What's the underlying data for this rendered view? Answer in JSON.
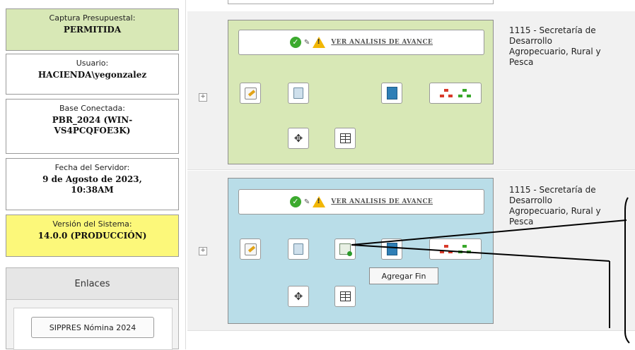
{
  "sidebar": {
    "captura": {
      "label": "Captura Presupuestal:",
      "value": "PERMITIDA"
    },
    "usuario": {
      "label": "Usuario:",
      "value": "HACIENDA\\yegonzalez"
    },
    "base": {
      "label": "Base Conectada:",
      "value_line1": "PBR_2024 (WIN-",
      "value_line2": "VS4PCQFOE3K)"
    },
    "fecha": {
      "label": "Fecha del Servidor:",
      "value_line1": "9 de Agosto de 2023,",
      "value_line2": "10:38AM"
    },
    "version": {
      "label": "Versión del Sistema:",
      "value": "14.0.0 (PRODUCCIÓN)"
    },
    "enlaces": {
      "title": "Enlaces",
      "link_label": "SIPPRES Nómina 2024"
    }
  },
  "rows": [
    {
      "expander": "+",
      "status_bar_label": "VER ANALISIS DE AVANCE",
      "dept_lines": [
        "1115 - Secretaría de",
        "Desarrollo",
        "Agropecuario, Rural y",
        "Pesca"
      ]
    },
    {
      "expander": "+",
      "status_bar_label": "VER ANALISIS DE AVANCE",
      "dept_lines": [
        "1115 - Secretaría de",
        "Desarrollo",
        "Agropecuario, Rural y",
        "Pesca"
      ]
    }
  ],
  "tooltip": "Agregar Fin",
  "icons": {
    "ok": "check-circle-icon",
    "pencil": "pencil-icon",
    "warning": "warning-icon",
    "edit": "edit-icon",
    "delete": "trash-icon",
    "book": "book-icon",
    "add_fin": "add-fin-icon",
    "tree": "hierarchy-icon",
    "move": "move-icon",
    "table": "table-icon"
  },
  "colors": {
    "green_panel": "#d8e8b6",
    "blue_panel": "#b9dde8",
    "yellow_box": "#fcf87a"
  }
}
